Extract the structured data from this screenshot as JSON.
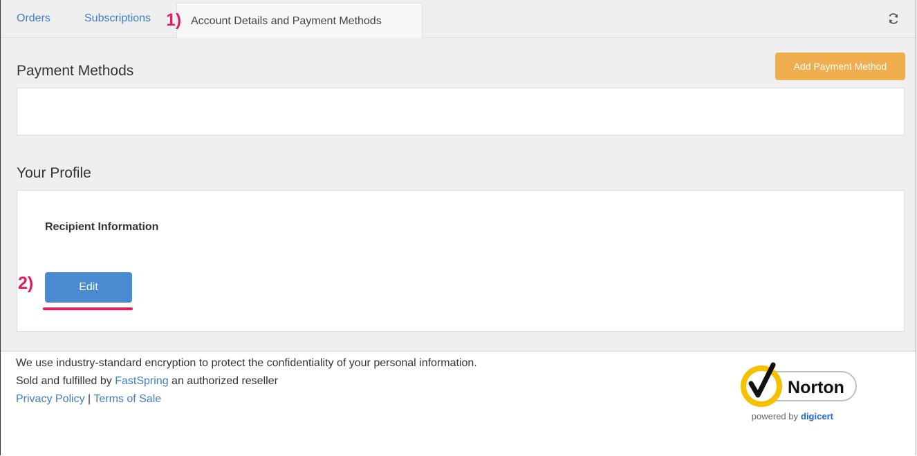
{
  "tabs": {
    "orders": "Orders",
    "subscriptions": "Subscriptions",
    "account": "Account Details and Payment Methods"
  },
  "annotations": {
    "step1": "1)",
    "step2": "2)"
  },
  "payment": {
    "title": "Payment Methods",
    "add_button": "Add Payment Method"
  },
  "profile": {
    "title": "Your Profile",
    "recipient_heading": "Recipient Information",
    "edit_button": "Edit"
  },
  "footer": {
    "encryption": "We use industry-standard encryption to protect the confidentiality of your personal information.",
    "sold_prefix": "Sold and fulfilled by",
    "fastspring": "FastSpring",
    "sold_suffix": "an authorized reseller",
    "privacy": "Privacy Policy",
    "separator": "|",
    "terms": "Terms of Sale"
  },
  "badge": {
    "brand": "Norton",
    "powered": "powered by",
    "digicert": "digicert"
  },
  "colors": {
    "link": "#3d7dc6",
    "accent_orange": "#f0ad4e",
    "edit_blue": "#4a8ad0",
    "annotation": "#e8195f"
  }
}
